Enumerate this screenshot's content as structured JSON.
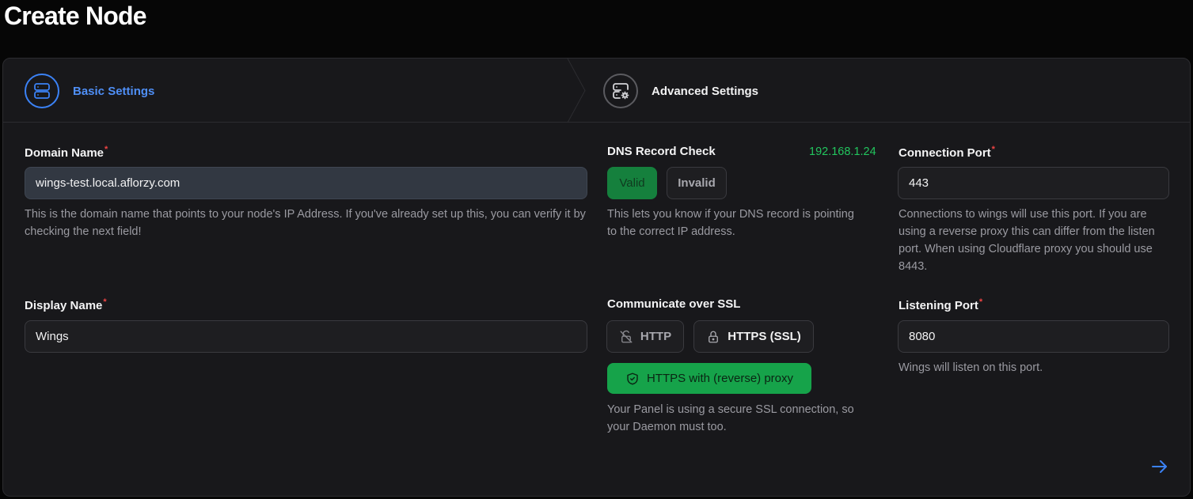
{
  "page": {
    "title": "Create Node"
  },
  "wizard": {
    "steps": [
      {
        "label": "Basic Settings",
        "state": "active"
      },
      {
        "label": "Advanced Settings",
        "state": "inactive"
      }
    ]
  },
  "form": {
    "domain_name": {
      "label": "Domain Name",
      "required_mark": "*",
      "value": "wings-test.local.aflorzy.com",
      "help": "This is the domain name that points to your node's IP Address. If you've already set up this, you can verify it by checking the next field!"
    },
    "dns_check": {
      "label": "DNS Record Check",
      "ip": "192.168.1.24",
      "valid_label": "Valid",
      "invalid_label": "Invalid",
      "help": "This lets you know if your DNS record is pointing to the correct IP address."
    },
    "connection_port": {
      "label": "Connection Port",
      "required_mark": "*",
      "value": "443",
      "help": "Connections to wings will use this port. If you are using a reverse proxy this can differ from the listen port. When using Cloudflare proxy you should use 8443."
    },
    "display_name": {
      "label": "Display Name",
      "required_mark": "*",
      "value": "Wings"
    },
    "ssl": {
      "label": "Communicate over SSL",
      "http_label": "HTTP",
      "https_label": "HTTPS (SSL)",
      "proxy_label": "HTTPS with (reverse) proxy",
      "help": "Your Panel is using a secure SSL connection, so your Daemon must too."
    },
    "listening_port": {
      "label": "Listening Port",
      "required_mark": "*",
      "value": "8080",
      "help": "Wings will listen on this port."
    }
  },
  "colors": {
    "accent": "#3b82f6",
    "success": "#16a34a",
    "required": "#ef4444",
    "card_bg": "#18181b"
  },
  "icons": {
    "step1": "server-icon",
    "step2": "server-cog-icon",
    "http": "lock-open-off-icon",
    "https": "lock-icon",
    "proxy": "shield-check-icon",
    "next": "arrow-right-icon"
  }
}
